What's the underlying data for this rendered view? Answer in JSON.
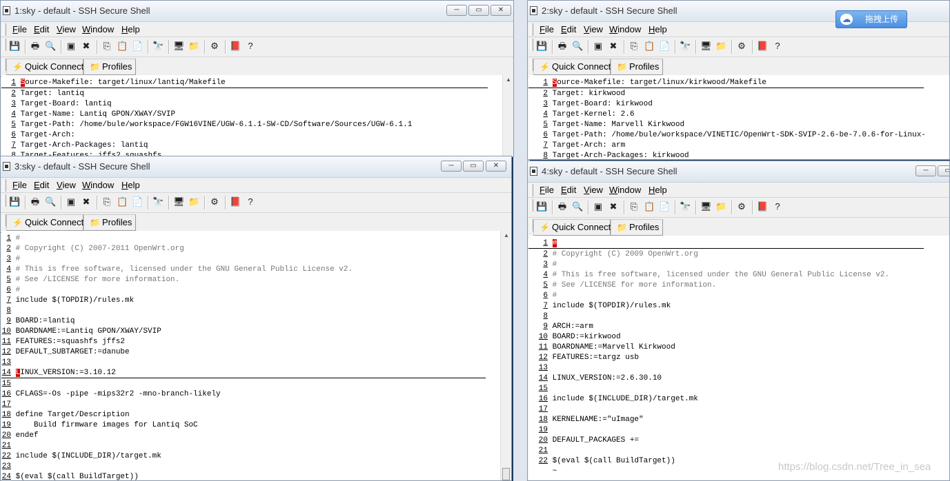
{
  "menu": [
    "File",
    "Edit",
    "View",
    "Window",
    "Help"
  ],
  "quick_connect_label": "Quick Connect",
  "profiles_label": "Profiles",
  "windows": [
    {
      "title": "1:sky - default - SSH Secure Shell",
      "lines": [
        {
          "n": "1",
          "t": "Source-Makefile: target/linux/lantiq/Makefile",
          "cursor": true
        },
        {
          "n": "2",
          "t": "Target: lantiq"
        },
        {
          "n": "3",
          "t": "Target-Board: lantiq"
        },
        {
          "n": "4",
          "t": "Target-Name: Lantiq GPON/XWAY/SVIP"
        },
        {
          "n": "5",
          "t": "Target-Path: /home/bule/workspace/FGW16VINE/UGW-6.1.1-SW-CD/Software/Sources/UGW-6.1.1"
        },
        {
          "n": "6",
          "t": "Target-Arch:"
        },
        {
          "n": "7",
          "t": "Target-Arch-Packages: lantiq"
        },
        {
          "n": "8",
          "t": "Target-Features: jffs2 squashfs"
        }
      ]
    },
    {
      "title": "2:sky - default - SSH Secure Shell",
      "lines": [
        {
          "n": "1",
          "t": "Source-Makefile: target/linux/kirkwood/Makefile",
          "cursor": true
        },
        {
          "n": "2",
          "t": "Target: kirkwood"
        },
        {
          "n": "3",
          "t": "Target-Board: kirkwood"
        },
        {
          "n": "4",
          "t": "Target-Kernel: 2.6"
        },
        {
          "n": "5",
          "t": "Target-Name: Marvell Kirkwood"
        },
        {
          "n": "6",
          "t": "Target-Path: /home/bule/workspace/VINETIC/OpenWrt-SDK-SVIP-2.6-be-7.0.6-for-Linux-"
        },
        {
          "n": "7",
          "t": "Target-Arch: arm"
        },
        {
          "n": "8",
          "t": "Target-Arch-Packages: kirkwood"
        }
      ]
    },
    {
      "title": "3:sky - default - SSH Secure Shell",
      "lines": [
        {
          "n": "1",
          "t": "#",
          "c": true
        },
        {
          "n": "2",
          "t": "# Copyright (C) 2007-2011 OpenWrt.org",
          "c": true
        },
        {
          "n": "3",
          "t": "#",
          "c": true
        },
        {
          "n": "4",
          "t": "# This is free software, licensed under the GNU General Public License v2.",
          "c": true
        },
        {
          "n": "5",
          "t": "# See /LICENSE for more information.",
          "c": true
        },
        {
          "n": "6",
          "t": "#",
          "c": true
        },
        {
          "n": "7",
          "t": "include $(TOPDIR)/rules.mk"
        },
        {
          "n": "8",
          "t": ""
        },
        {
          "n": "9",
          "t": "BOARD:=lantiq"
        },
        {
          "n": "10",
          "t": "BOARDNAME:=Lantiq GPON/XWAY/SVIP"
        },
        {
          "n": "11",
          "t": "FEATURES:=squashfs jffs2"
        },
        {
          "n": "12",
          "t": "DEFAULT_SUBTARGET:=danube"
        },
        {
          "n": "13",
          "t": ""
        },
        {
          "n": "14",
          "t": "LINUX_VERSION:=3.10.12",
          "cursor": true
        },
        {
          "n": "15",
          "t": ""
        },
        {
          "n": "16",
          "t": "CFLAGS=-Os -pipe -mips32r2 -mno-branch-likely"
        },
        {
          "n": "17",
          "t": ""
        },
        {
          "n": "18",
          "t": "define Target/Description"
        },
        {
          "n": "19",
          "t": "    Build firmware images for Lantiq SoC"
        },
        {
          "n": "20",
          "t": "endef"
        },
        {
          "n": "21",
          "t": ""
        },
        {
          "n": "22",
          "t": "include $(INCLUDE_DIR)/target.mk"
        },
        {
          "n": "23",
          "t": ""
        },
        {
          "n": "24",
          "t": "$(eval $(call BuildTarget))"
        }
      ]
    },
    {
      "title": "4:sky - default - SSH Secure Shell",
      "lines": [
        {
          "n": "1",
          "t": "#",
          "cursor": true
        },
        {
          "n": "2",
          "t": "# Copyright (C) 2009 OpenWrt.org",
          "c": true
        },
        {
          "n": "3",
          "t": "#",
          "c": true
        },
        {
          "n": "4",
          "t": "# This is free software, licensed under the GNU General Public License v2.",
          "c": true
        },
        {
          "n": "5",
          "t": "# See /LICENSE for more information.",
          "c": true
        },
        {
          "n": "6",
          "t": "#",
          "c": true
        },
        {
          "n": "7",
          "t": "include $(TOPDIR)/rules.mk"
        },
        {
          "n": "8",
          "t": ""
        },
        {
          "n": "9",
          "t": "ARCH:=arm"
        },
        {
          "n": "10",
          "t": "BOARD:=kirkwood"
        },
        {
          "n": "11",
          "t": "BOARDNAME:=Marvell Kirkwood"
        },
        {
          "n": "12",
          "t": "FEATURES:=targz usb"
        },
        {
          "n": "13",
          "t": ""
        },
        {
          "n": "14",
          "t": "LINUX_VERSION:=2.6.30.10"
        },
        {
          "n": "15",
          "t": ""
        },
        {
          "n": "16",
          "t": "include $(INCLUDE_DIR)/target.mk"
        },
        {
          "n": "17",
          "t": ""
        },
        {
          "n": "18",
          "t": "KERNELNAME:=\"uImage\""
        },
        {
          "n": "19",
          "t": ""
        },
        {
          "n": "20",
          "t": "DEFAULT_PACKAGES +="
        },
        {
          "n": "21",
          "t": ""
        },
        {
          "n": "22",
          "t": "$(eval $(call BuildTarget))"
        },
        {
          "n": "",
          "t": "~"
        }
      ]
    }
  ],
  "upload_button": "拖拽上传",
  "watermark": "https://blog.csdn.net/Tree_in_sea"
}
